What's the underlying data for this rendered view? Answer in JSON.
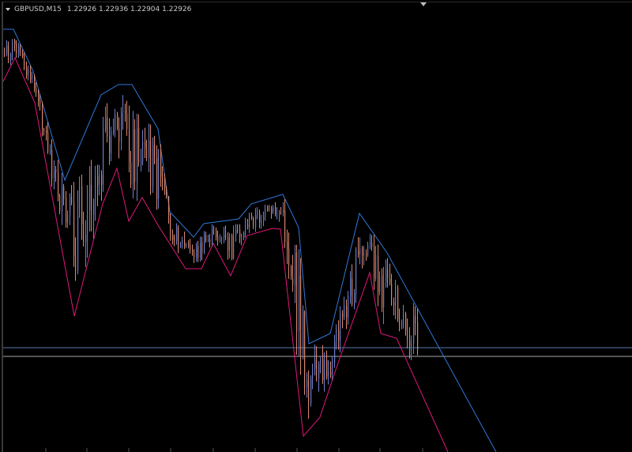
{
  "header": {
    "symbol": "GBPUSD,M15",
    "ohlc": "1.22926 1.22936 1.22904 1.22926"
  },
  "colors": {
    "background": "#000000",
    "bull_candle": "#6f7ec8",
    "bear_candle": "#d98870",
    "upper_line": "#2f78d8",
    "lower_line": "#e0187a",
    "level_blue": "#5a7ab0",
    "level_gray": "#a8a8a8",
    "frame": "#3a3a3a"
  },
  "icons": {
    "menu": "triangle-down-icon",
    "shift": "shift-marker-triangle"
  }
}
